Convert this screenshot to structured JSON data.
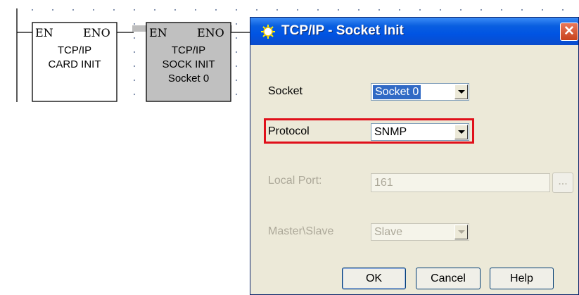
{
  "ladder": {
    "block1": {
      "pin_in": "EN",
      "pin_out": "ENO",
      "line1": "TCP/IP",
      "line2": "CARD INIT"
    },
    "block2": {
      "pin_in": "EN",
      "pin_out": "ENO",
      "line1": "TCP/IP",
      "line2": "SOCK INIT",
      "line3": "Socket 0"
    }
  },
  "dialog": {
    "title": "TCP/IP - Socket Init",
    "close_label": "✕",
    "socket_label": "Socket",
    "socket_value": "Socket 0",
    "protocol_label": "Protocol",
    "protocol_value": "SNMP",
    "local_port_label": "Local Port:",
    "local_port_value": "161",
    "browse_label": "...",
    "master_slave_label": "Master\\Slave",
    "master_slave_value": "Slave",
    "ok_label": "OK",
    "cancel_label": "Cancel",
    "help_label": "Help",
    "colors": {
      "title_bar": "#0054e3",
      "highlight": "#e0101a",
      "selection": "#316ac5"
    }
  }
}
